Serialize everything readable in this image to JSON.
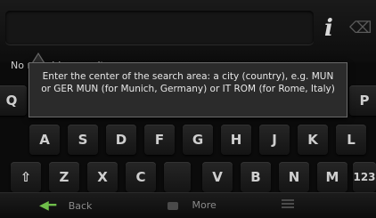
{
  "search": {
    "info_icon": "i",
    "backspace_icon": "backspace-icon"
  },
  "results": {
    "status_text": "No matching results"
  },
  "tooltip": {
    "text": "Enter the center of the search area: a city (country), e.g. MUN or GER MUN (for Munich, Germany) or IT ROM (for Rome, Italy)"
  },
  "keyboard": {
    "row1": [
      "Q",
      "",
      "",
      "",
      "",
      "",
      "",
      "",
      "",
      "P"
    ],
    "row2": [
      "A",
      "S",
      "D",
      "F",
      "G",
      "H",
      "J",
      "K",
      "L"
    ],
    "row3": [
      "⇧",
      "Z",
      "X",
      "C",
      "",
      "V",
      "B",
      "N",
      "M",
      "123"
    ]
  },
  "bottombar": {
    "back_label": "Back",
    "more_label": "More"
  },
  "colors": {
    "accent_green": "#6fbf4a"
  }
}
